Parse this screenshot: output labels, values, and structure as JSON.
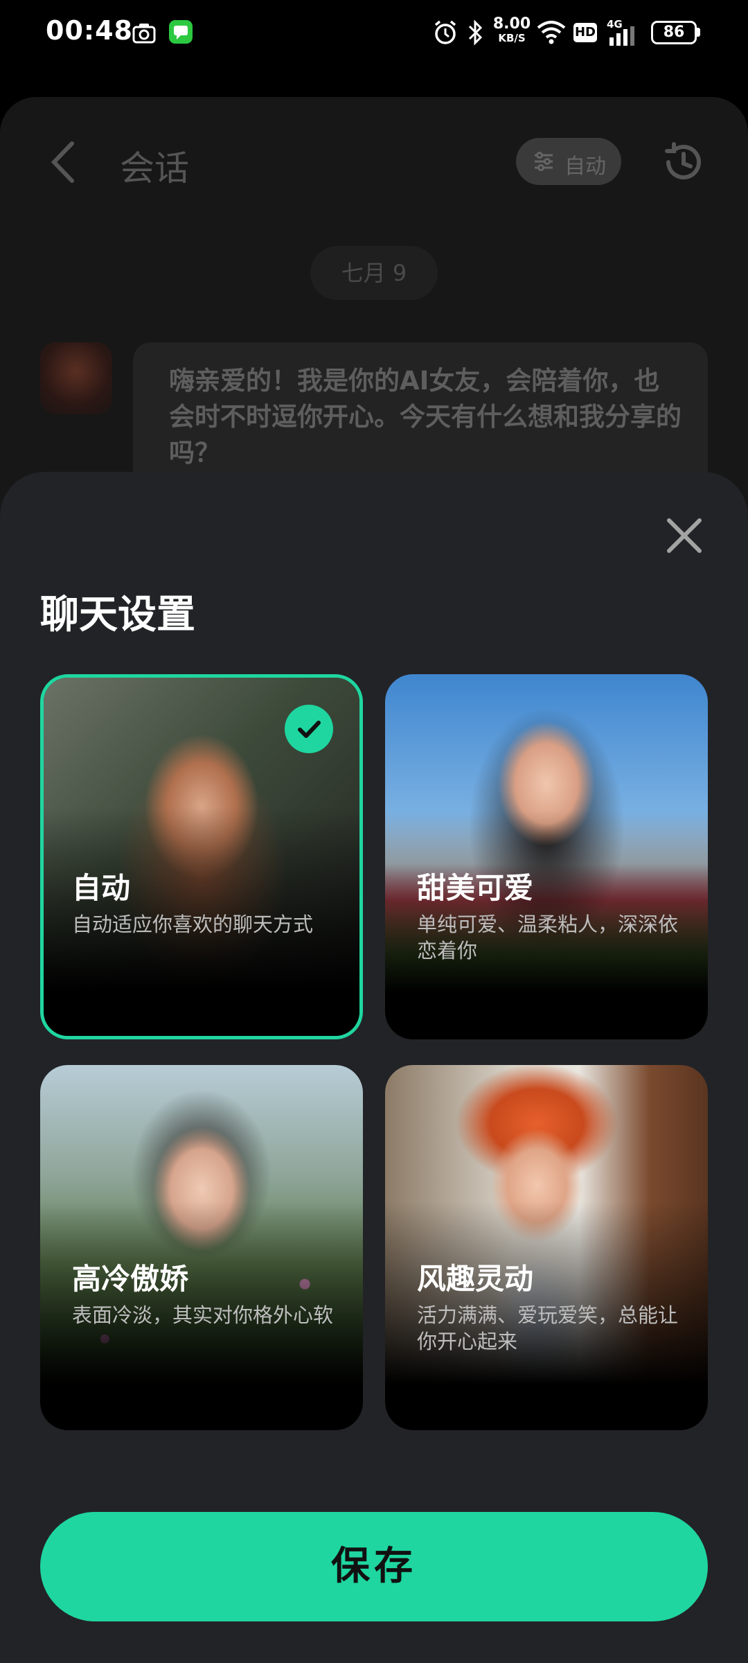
{
  "status_bar": {
    "time": "00:48",
    "network_speed_value": "8.00",
    "network_speed_unit": "KB/S",
    "hd": "HD",
    "cell": "4G",
    "battery": "86"
  },
  "chat_background": {
    "title": "会话",
    "mode_label": "自动",
    "date_chip": "七月 9",
    "message": "嗨亲爱的！我是你的AI女友，会陪着你，也会时不时逗你开心。今天有什么想和我分享的吗？"
  },
  "sheet": {
    "title": "聊天设置",
    "cards": [
      {
        "name": "自动",
        "desc": "自动适应你喜欢的聊天方式",
        "selected": true
      },
      {
        "name": "甜美可爱",
        "desc": "单纯可爱、温柔粘人，深深依恋着你",
        "selected": false
      },
      {
        "name": "高冷傲娇",
        "desc": "表面冷淡，其实对你格外心软",
        "selected": false
      },
      {
        "name": "风趣灵动",
        "desc": "活力满满、爱玩爱笑，总能让你开心起来",
        "selected": false
      }
    ],
    "save_label": "保存"
  },
  "colors": {
    "accent": "#1fd6a0",
    "sheet_bg": "#222327"
  }
}
